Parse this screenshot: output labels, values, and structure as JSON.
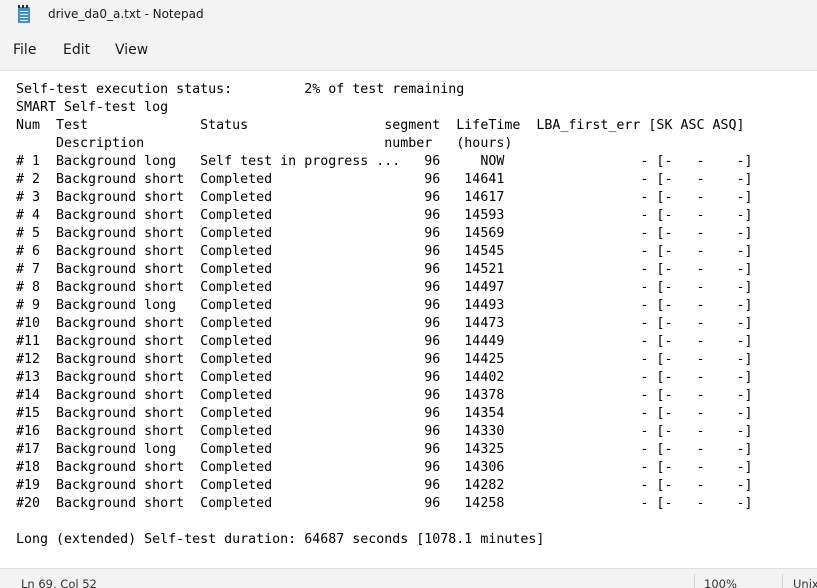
{
  "window": {
    "title": "drive_da0_a.txt - Notepad",
    "app_icon": "notepad-icon"
  },
  "menu": {
    "file": "File",
    "edit": "Edit",
    "view": "View"
  },
  "editor": {
    "lines": [
      "Self-test execution status:         2% of test remaining",
      "SMART Self-test log",
      "Num  Test              Status                 segment  LifeTime  LBA_first_err [SK ASC ASQ]",
      "     Description                              number   (hours)",
      "# 1  Background long   Self test in progress ...   96     NOW                 - [-   -    -]",
      "# 2  Background short  Completed                   96   14641                 - [-   -    -]",
      "# 3  Background short  Completed                   96   14617                 - [-   -    -]",
      "# 4  Background short  Completed                   96   14593                 - [-   -    -]",
      "# 5  Background short  Completed                   96   14569                 - [-   -    -]",
      "# 6  Background short  Completed                   96   14545                 - [-   -    -]",
      "# 7  Background short  Completed                   96   14521                 - [-   -    -]",
      "# 8  Background short  Completed                   96   14497                 - [-   -    -]",
      "# 9  Background long   Completed                   96   14493                 - [-   -    -]",
      "#10  Background short  Completed                   96   14473                 - [-   -    -]",
      "#11  Background short  Completed                   96   14449                 - [-   -    -]",
      "#12  Background short  Completed                   96   14425                 - [-   -    -]",
      "#13  Background short  Completed                   96   14402                 - [-   -    -]",
      "#14  Background short  Completed                   96   14378                 - [-   -    -]",
      "#15  Background short  Completed                   96   14354                 - [-   -    -]",
      "#16  Background short  Completed                   96   14330                 - [-   -    -]",
      "#17  Background long   Completed                   96   14325                 - [-   -    -]",
      "#18  Background short  Completed                   96   14306                 - [-   -    -]",
      "#19  Background short  Completed                   96   14282                 - [-   -    -]",
      "#20  Background short  Completed                   96   14258                 - [-   -    -]",
      "",
      "Long (extended) Self-test duration: 64687 seconds [1078.1 minutes]"
    ]
  },
  "status": {
    "cursor": "Ln 69, Col 52",
    "zoom": "100%",
    "eol": "Unix"
  }
}
